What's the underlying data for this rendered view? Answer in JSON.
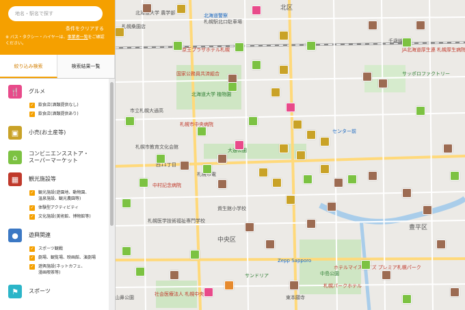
{
  "search": {
    "placeholder": "地名・駅名で探す"
  },
  "clear_link": "条件をクリアする",
  "notice": {
    "prefix": "※ バス・タクシー・ハイヤーは、",
    "link": "事業者一覧",
    "suffix": "をご確認ください。"
  },
  "tabs": [
    {
      "label": "絞り込み検索"
    },
    {
      "label": "検索結果一覧"
    }
  ],
  "categories": [
    {
      "label": "グルメ",
      "color": "#e84a8a",
      "icon": "fork-knife-icon"
    },
    {
      "label": "小売(お土産等)",
      "color": "#c9a227",
      "icon": "shopping-bag-icon"
    },
    {
      "label": "コンビニエンスストア・スーパーマーケット",
      "label1": "コンビニエンスストア・",
      "label2": "スーパーマーケット",
      "color": "#7cc242",
      "icon": "store-icon"
    },
    {
      "label": "観光施設等",
      "color": "#c0392b",
      "icon": "building-icon"
    },
    {
      "label": "遊興関連",
      "color": "#3b78c4",
      "icon": "bowling-icon"
    },
    {
      "label": "スポーツ",
      "color": "#2bb5c8",
      "icon": "sports-icon"
    }
  ],
  "subs": {
    "gourmet": [
      "飲食店(酒類提供なし)",
      "飲食店(酒類提供あり)"
    ],
    "sightseeing": [
      "観光施設(遊園地、動物園、",
      "温泉施設、観光農園等)",
      "体験型アクティビティ",
      "文化施設(美術館、博物館等)"
    ],
    "leisure": [
      "スポーツ観戦",
      "劇場、観覧場、映画館、演劇場",
      "遊興施設(ネットカフェ、",
      "漫画喫茶等)"
    ]
  },
  "map_labels": {
    "l1": "北海道大学 農学部",
    "l2": "北海道警察",
    "l3": "札幌駅北口駐車場",
    "l4": "札幌桑園店",
    "l5": "京王プラザホテル札幌",
    "l6": "北海道大学 植物園",
    "l7": "市立札幌大通高",
    "l8": "国家公務員共済組合",
    "l9": "札幌市教育文化会館",
    "l10": "中村記念病院",
    "l11": "札幌医学技術福祉専門学校",
    "l12": "札幌市中央病院",
    "l13": "サッポロファクトリー",
    "l14": "JA北海道厚生連 札幌厚生病院",
    "l15": "東本願寺",
    "l16": "中島公園",
    "l17": "札幌パークホテル",
    "l18": "山鼻公園",
    "l19": "資生館小学校",
    "l20": "Zepp Sapporo",
    "l21": "ホテルマイステイズ プレミア札幌パーク",
    "l22": "北区",
    "l23": "中央区",
    "l24": "豊平区",
    "l25": "千歳線",
    "l26": "センター前",
    "l27": "西11丁目",
    "l28": "札幌市電",
    "l29": "社会医療法人 札幌中央病院",
    "l30": "サンドリア",
    "l31": "大通公園"
  }
}
